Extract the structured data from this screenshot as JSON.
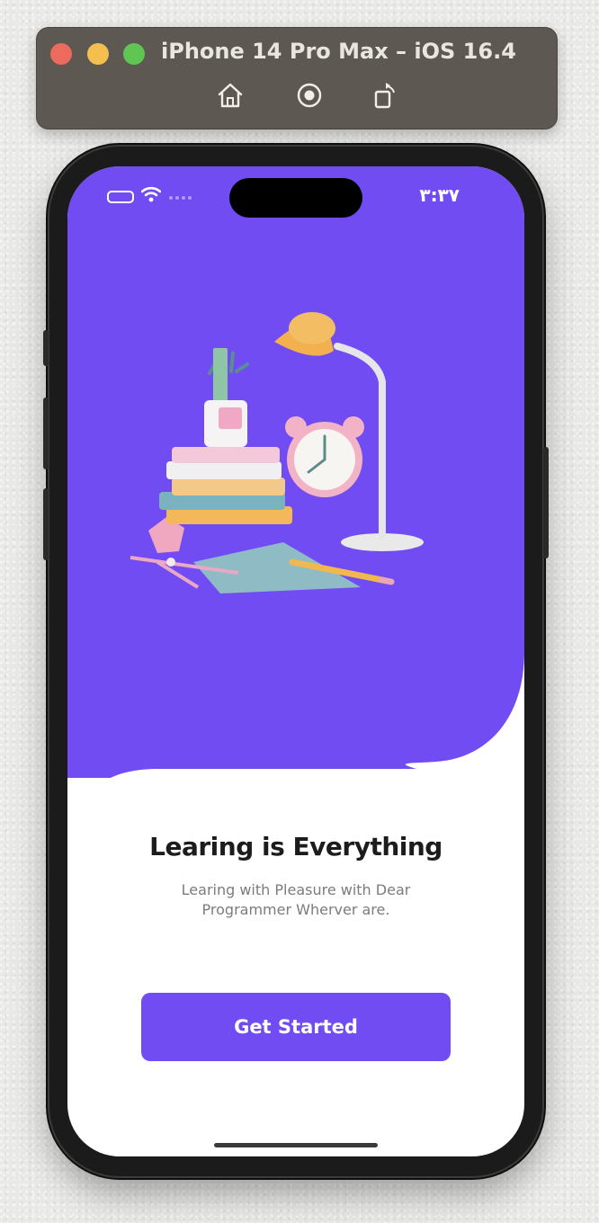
{
  "simulator": {
    "title": "iPhone 14 Pro Max – iOS 16.4",
    "tools": [
      "home-icon",
      "screenshot-icon",
      "rotate-icon"
    ]
  },
  "status_bar": {
    "time": "۳:۳۷",
    "icons": [
      "battery-icon",
      "wifi-icon",
      "signal-icon"
    ]
  },
  "onboarding": {
    "title": "Learing is Everything",
    "subtitle": "Learing with Pleasure with Dear Programmer Wherver are.",
    "cta_label": "Get Started"
  },
  "colors": {
    "accent": "#714cf3",
    "background": "#ffffff",
    "title": "#1c1c1e",
    "subtitle": "#7b7b80"
  }
}
